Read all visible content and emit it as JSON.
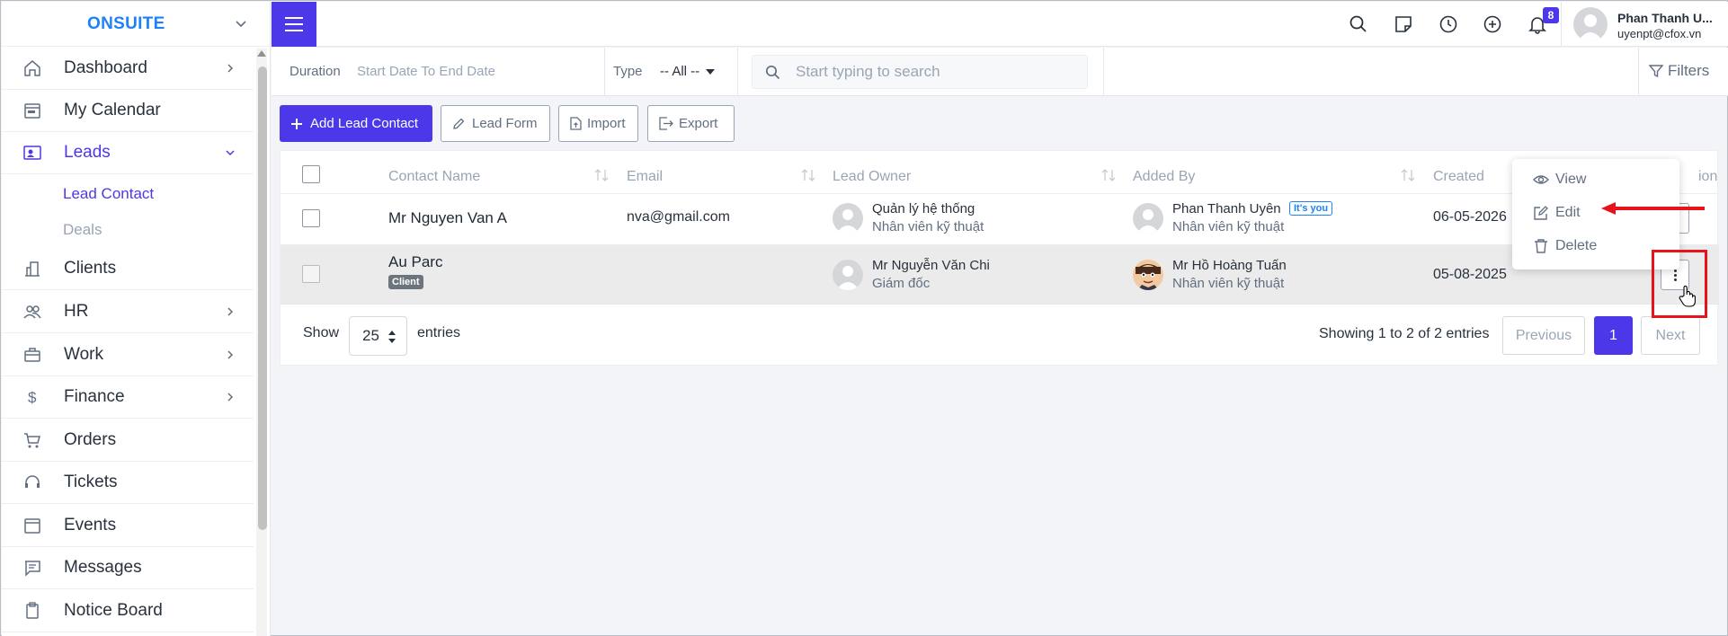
{
  "app": {
    "brand": "ONSUITE"
  },
  "sidebar": {
    "items": [
      {
        "label": "Dashboard",
        "icon": "home-icon",
        "has_arrow": true
      },
      {
        "label": "My Calendar",
        "icon": "calendar-icon",
        "has_arrow": false
      },
      {
        "label": "Leads",
        "icon": "contact-card-icon",
        "has_arrow": true,
        "expanded": true
      },
      {
        "label": "Clients",
        "icon": "building-icon",
        "has_arrow": false
      },
      {
        "label": "HR",
        "icon": "people-icon",
        "has_arrow": true
      },
      {
        "label": "Work",
        "icon": "briefcase-icon",
        "has_arrow": true
      },
      {
        "label": "Finance",
        "icon": "dollar-icon",
        "has_arrow": true
      },
      {
        "label": "Orders",
        "icon": "cart-icon",
        "has_arrow": false
      },
      {
        "label": "Tickets",
        "icon": "headset-icon",
        "has_arrow": false
      },
      {
        "label": "Events",
        "icon": "calendar-event-icon",
        "has_arrow": false
      },
      {
        "label": "Messages",
        "icon": "message-icon",
        "has_arrow": false
      },
      {
        "label": "Notice Board",
        "icon": "clipboard-icon",
        "has_arrow": false
      }
    ],
    "sub_items": [
      {
        "label": "Lead Contact",
        "active": true
      },
      {
        "label": "Deals",
        "active": false
      }
    ]
  },
  "topbar": {
    "notification_count": "8",
    "user_name": "Phan Thanh U...",
    "user_email": "uyenpt@cfox.vn"
  },
  "filters": {
    "duration_label": "Duration",
    "duration_value": "Start Date To End Date",
    "type_label": "Type",
    "type_value": "-- All --",
    "search_placeholder": "Start typing to search",
    "filters_label": "Filters"
  },
  "actions": {
    "add": "Add Lead Contact",
    "form": "Lead Form",
    "import": "Import",
    "export": "Export"
  },
  "table": {
    "headers": [
      "Contact Name",
      "Email",
      "Lead Owner",
      "Added By",
      "Created",
      "ion"
    ],
    "rows": [
      {
        "name": "Mr Nguyen Van A",
        "email": "nva@gmail.com",
        "owner_name": "Quản lý hệ thống",
        "owner_role": "Nhân viên kỹ thuật",
        "added_name": "Phan Thanh Uyên",
        "added_badge": "It's you",
        "added_role": "Nhân viên kỹ thuật",
        "created": "06-05-2026"
      },
      {
        "name": "Au Parc",
        "badge": "Client",
        "email": "",
        "owner_name": "Mr Nguyễn Văn Chi",
        "owner_role": "Giám đốc",
        "added_name": "Mr Hồ Hoàng Tuấn",
        "added_role": "Nhân viên kỹ thuật",
        "created": "05-08-2025"
      }
    ],
    "show_label": "Show",
    "entries_value": "25",
    "entries_label": "entries",
    "info": "Showing 1 to 2 of 2 entries",
    "prev": "Previous",
    "page": "1",
    "next": "Next"
  },
  "dropdown": {
    "items": [
      "View",
      "Edit",
      "Delete"
    ]
  },
  "colors": {
    "primary": "#4c38e8",
    "brand": "#1d82f5",
    "annotation": "#e8121b"
  }
}
